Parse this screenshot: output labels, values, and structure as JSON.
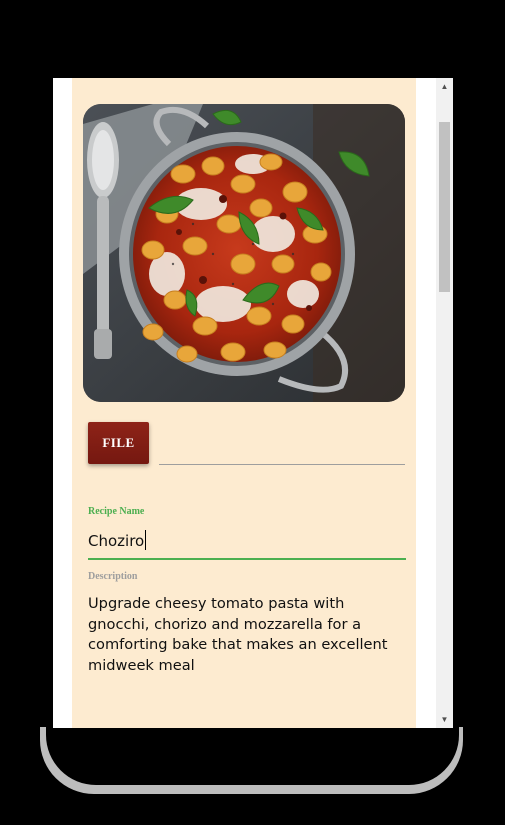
{
  "upload": {
    "button_label": "FILE",
    "file_path": ""
  },
  "form": {
    "recipe_name_label": "Recipe Name",
    "recipe_name_value": "Choziro",
    "description_label": "Description",
    "description_value": "Upgrade cheesy tomato pasta with gnocchi, chorizo and mozzarella for a comforting bake that makes an excellent midweek meal"
  },
  "scrollbar": {
    "up_arrow": "▲",
    "down_arrow": "▼"
  },
  "colors": {
    "card_background": "#fdebd0",
    "button_background": "#8e2318",
    "active_underline": "#4caf50",
    "inactive_label": "#9e9e9e"
  }
}
